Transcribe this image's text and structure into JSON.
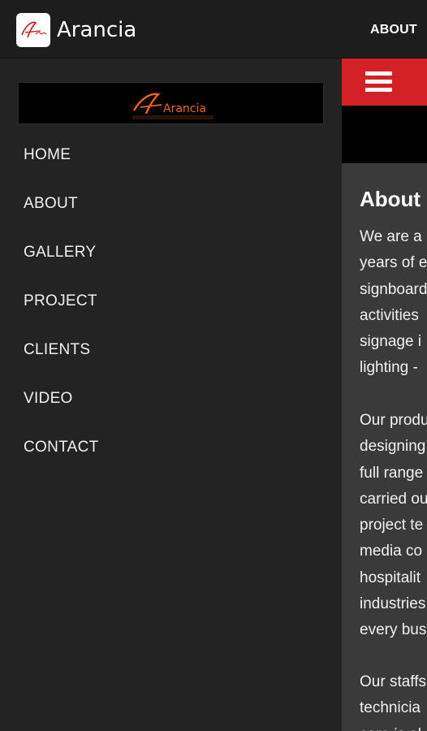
{
  "actionbar": {
    "title": "Arancia",
    "about_label": "ABOUT"
  },
  "icons": {
    "app_logo": "arancia-logo-icon",
    "menu": "hamburger-menu-icon"
  },
  "drawer": {
    "logo_text": "Arancia",
    "items": [
      {
        "label": "HOME"
      },
      {
        "label": "ABOUT"
      },
      {
        "label": "GALLERY"
      },
      {
        "label": "PROJECT"
      },
      {
        "label": "CLIENTS"
      },
      {
        "label": "VIDEO"
      },
      {
        "label": "CONTACT"
      }
    ]
  },
  "content": {
    "heading": "About",
    "paragraphs": [
      [
        "We are a",
        "years of e",
        "signboard",
        "activities",
        "signage i",
        "lighting -"
      ],
      [
        "Our produ",
        "designing",
        "full range",
        "carried ou",
        "project te",
        "media co",
        "hospitalit",
        "industries",
        "every bus"
      ],
      [
        "Our staffs",
        "technicia",
        "care is al"
      ]
    ]
  },
  "colors": {
    "accent_red": "#d42027",
    "logo_orange": "#e8641a",
    "background_dark": "#232323",
    "content_bg": "#3a3a3a"
  }
}
